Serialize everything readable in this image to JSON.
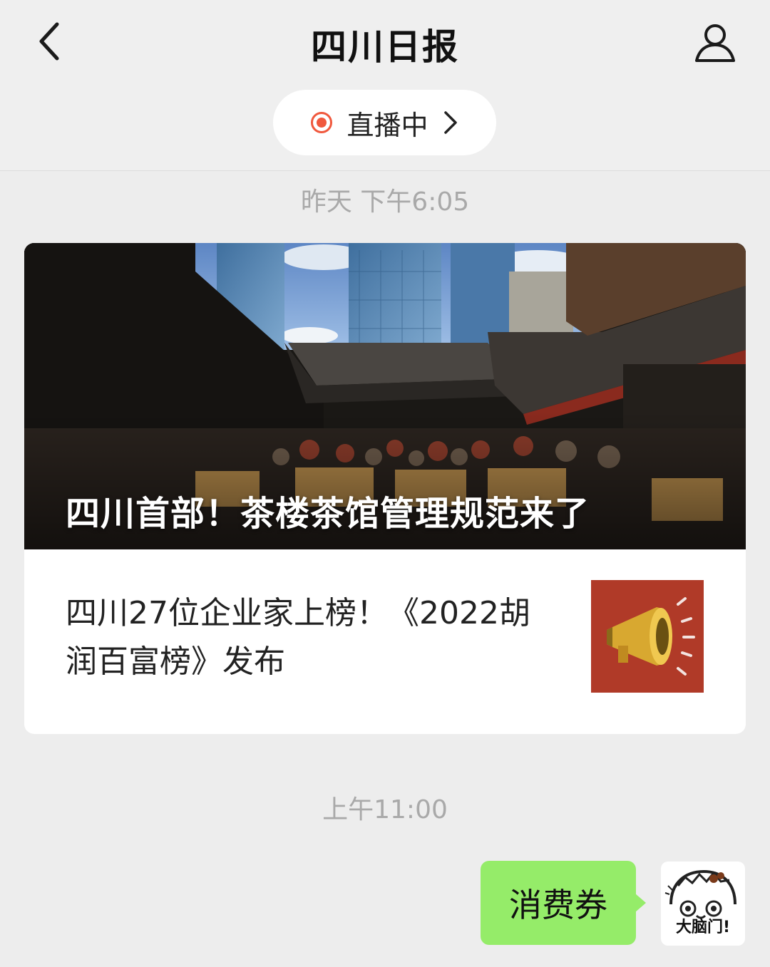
{
  "header": {
    "title": "四川日报",
    "back_icon": "chevron-left-icon",
    "profile_icon": "person-icon"
  },
  "live": {
    "label": "直播中",
    "accent": "#f0583d"
  },
  "messages": [
    {
      "timestamp": "昨天 下午6:05",
      "card": {
        "main_title": "四川首部！茶楼茶馆管理规范来了",
        "sub_title": "四川27位企业家上榜！《2022胡润百富榜》发布",
        "thumb_icon": "megaphone-icon",
        "thumb_color": "#b03a28"
      }
    },
    {
      "timestamp": "上午11:00",
      "bubble": "消费券",
      "bubble_color": "#95ec69",
      "avatar_text": "大脑门!"
    }
  ]
}
